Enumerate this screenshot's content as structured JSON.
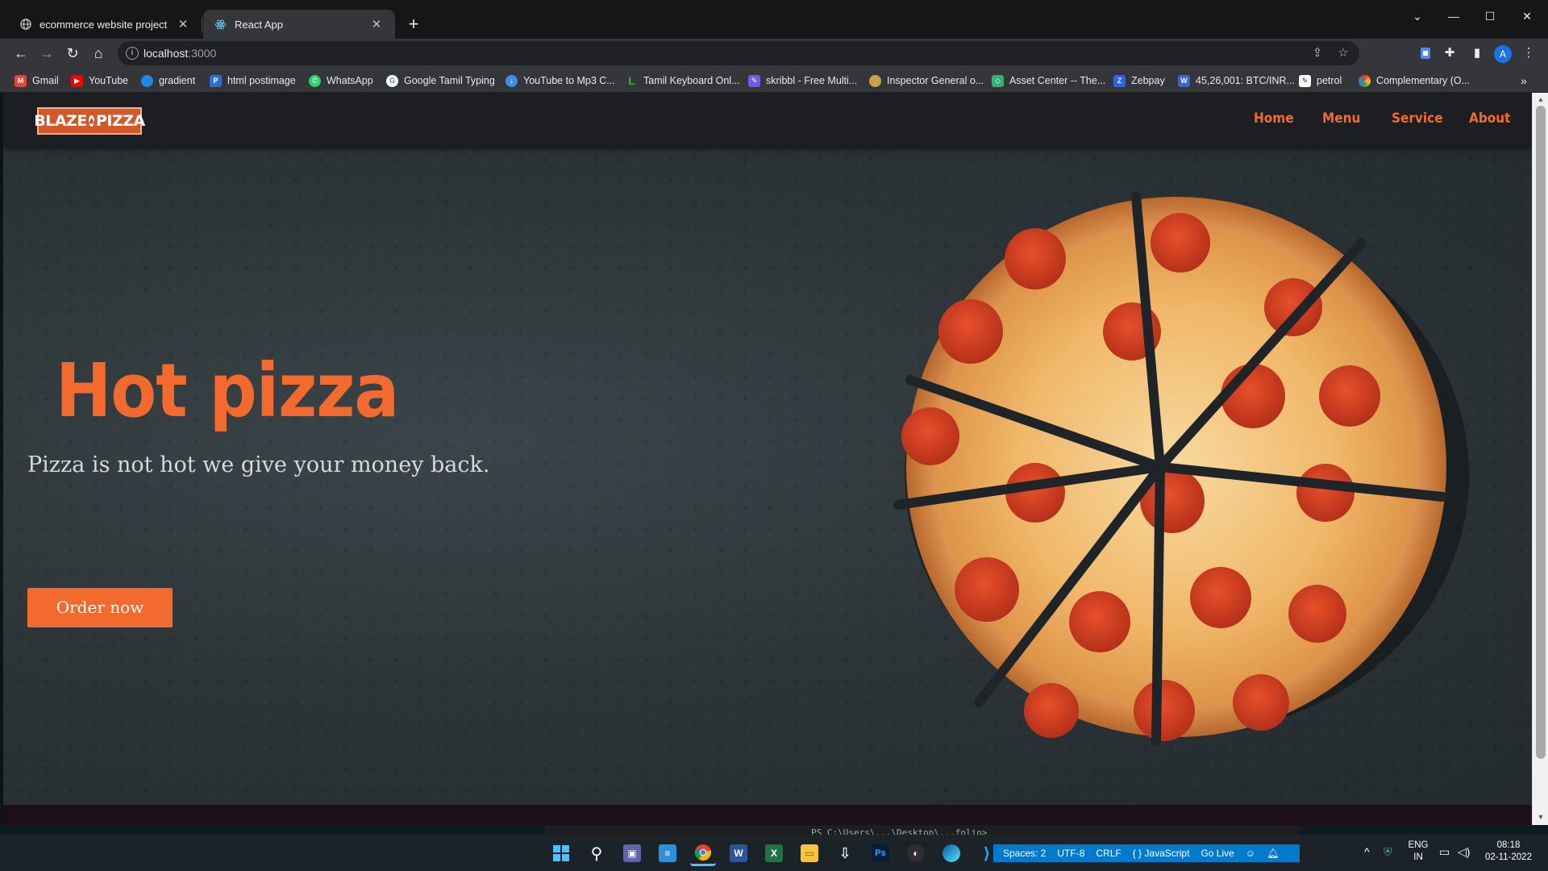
{
  "browser": {
    "tabs": [
      {
        "title": "ecommerce website project",
        "active": false
      },
      {
        "title": "React App",
        "active": true
      }
    ],
    "url_host": "localhost",
    "url_port": ":3000",
    "profile_initial": "A",
    "bookmarks": [
      {
        "label": "Gmail",
        "icon": "gmail-icon",
        "color": "#ea4335"
      },
      {
        "label": "YouTube",
        "icon": "youtube-icon",
        "color": "#ff0000"
      },
      {
        "label": "gradient",
        "icon": "gradient-icon",
        "color": "#1e88e5"
      },
      {
        "label": "html postimage",
        "icon": "postimage-icon",
        "color": "#2f6fd1"
      },
      {
        "label": "WhatsApp",
        "icon": "whatsapp-icon",
        "color": "#25d366"
      },
      {
        "label": "Google Tamil Typing",
        "icon": "google-icon",
        "color": "#4285f4"
      },
      {
        "label": "YouTube to Mp3 C...",
        "icon": "download-icon",
        "color": "#3a8ee6"
      },
      {
        "label": "Tamil Keyboard Onl...",
        "icon": "keyboard-l-icon",
        "color": "#33b44a"
      },
      {
        "label": "skribbl - Free Multi...",
        "icon": "skribbl-icon",
        "color": "#6c5ce7"
      },
      {
        "label": "Inspector General o...",
        "icon": "emblem-icon",
        "color": "#c9a24a"
      },
      {
        "label": "Asset Center -- The...",
        "icon": "asset-icon",
        "color": "#2bb673"
      },
      {
        "label": "Zebpay",
        "icon": "zebpay-icon",
        "color": "#2962ff"
      },
      {
        "label": "45,26,001: BTC/INR...",
        "icon": "wazirx-icon",
        "color": "#3367d6"
      },
      {
        "label": "petrol",
        "icon": "edit-icon",
        "color": "#9aa0a6"
      },
      {
        "label": "Complementary (O...",
        "icon": "colorwheel-icon",
        "color": "#e53935"
      }
    ]
  },
  "site": {
    "logo_left": "BLAZE",
    "logo_right": "PIZZA",
    "nav": [
      "Home",
      "Menu",
      "Service",
      "About"
    ],
    "hero_title": "Hot pizza",
    "hero_subtitle": "Pizza is not hot we give your money back.",
    "cta_label": "Order now",
    "accent": "#f26a2e"
  },
  "behind_window": {
    "terminal_text": "PS C:\\Users\\...\\Desktop\\...folio>"
  },
  "taskbar": {
    "vscode_status": [
      "Spaces: 2",
      "UTF-8",
      "CRLF",
      "{ } JavaScript",
      "Go Live"
    ],
    "language": "ENG",
    "region": "IN",
    "time": "08:18",
    "date": "02-11-2022"
  }
}
